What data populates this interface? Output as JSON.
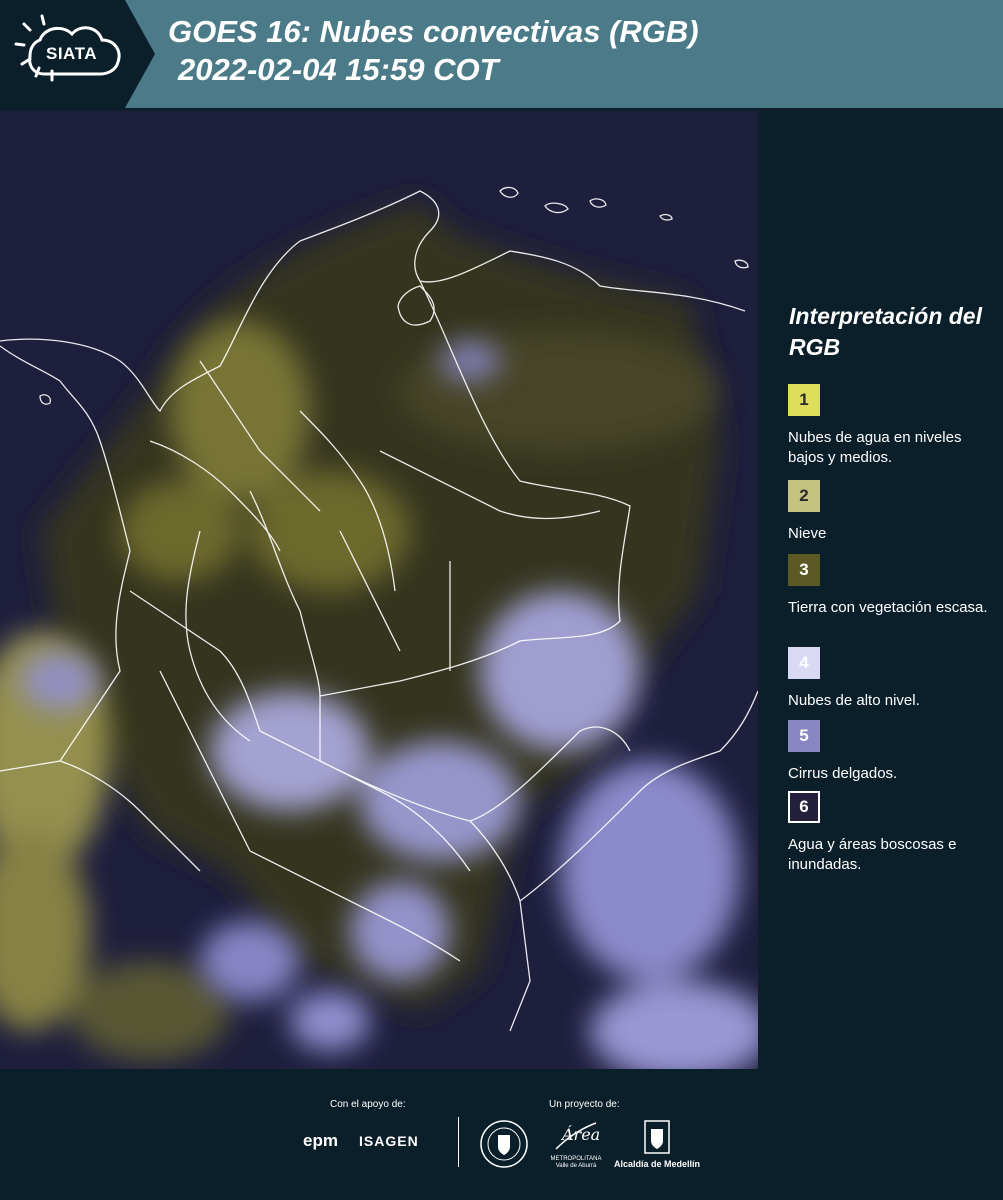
{
  "header": {
    "logo_text": "SIATA",
    "title_line1": "GOES 16: Nubes convectivas (RGB)",
    "title_line2": "2022-02-04 15:59 COT",
    "background_color": "#4b7b88"
  },
  "legend": {
    "title": "Interpretación del RGB",
    "items": [
      {
        "number": "1",
        "label": "Nubes de agua en niveles bajos y medios.",
        "color": "#dede5c"
      },
      {
        "number": "2",
        "label": "Nieve",
        "color": "#c4c382"
      },
      {
        "number": "3",
        "label": "Tierra con vegetación escasa.",
        "color": "#5b5a24"
      },
      {
        "number": "4",
        "label": "Nubes de alto nivel.",
        "color": "#dad9f3"
      },
      {
        "number": "5",
        "label": "Cirrus delgados.",
        "color": "#8986c3"
      },
      {
        "number": "6",
        "label": "Agua y áreas boscosas e inundadas.",
        "color": "#22203c"
      }
    ]
  },
  "footer": {
    "support_label": "Con el apoyo de:",
    "project_label": "Un proyecto de:",
    "epm_logo": "epm",
    "isagen_logo": "ISAGEN",
    "area_logo_word": "Área",
    "area_logo_sub": "METROPOLITANA Valle de Aburrá",
    "alcaldia_logo": "Alcaldía de Medellín"
  }
}
